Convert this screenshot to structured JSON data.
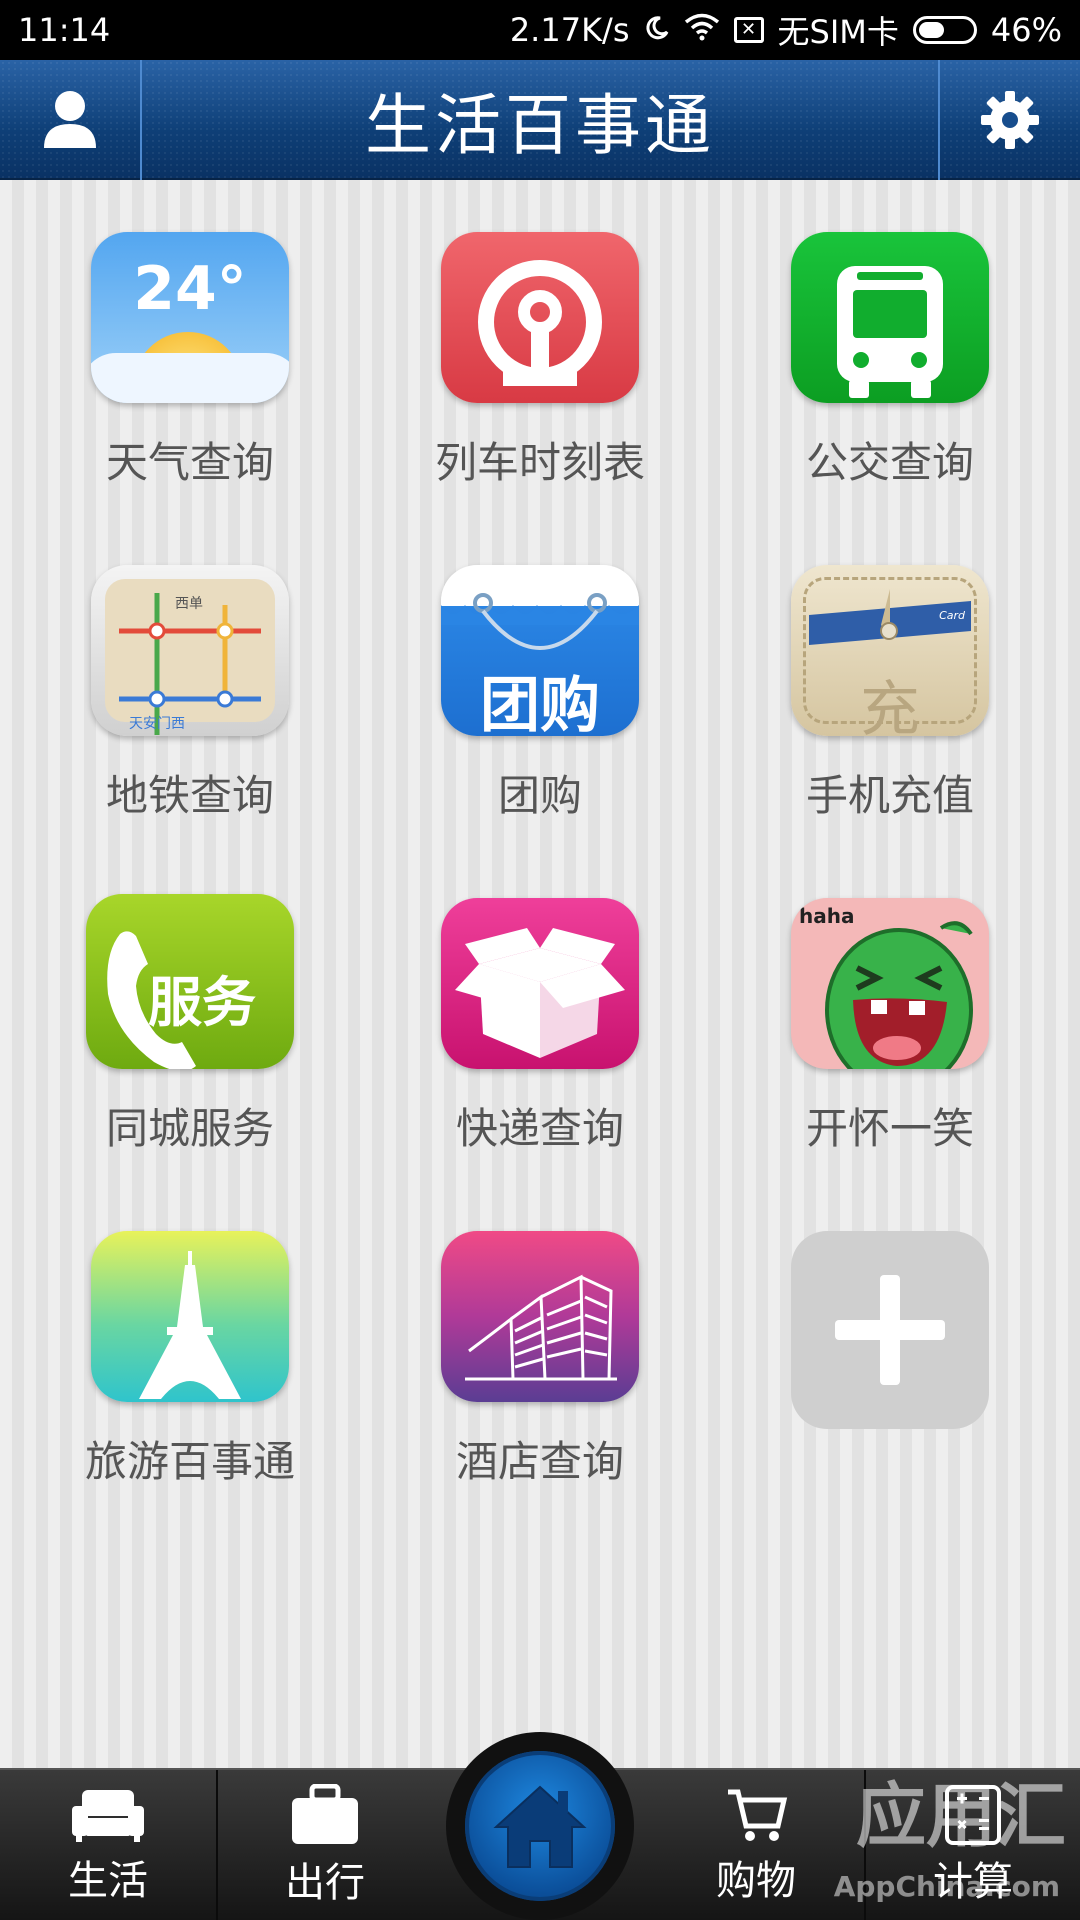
{
  "status_bar": {
    "time": "11:14",
    "speed": "2.17K/s",
    "sim": "无SIM卡",
    "battery": "46%"
  },
  "header": {
    "title": "生活百事通",
    "left_icon": "user-icon",
    "right_icon": "gear-icon"
  },
  "tiles": [
    {
      "label": "天气查询",
      "icon": "weather-icon",
      "text": "24°"
    },
    {
      "label": "列车时刻表",
      "icon": "train-icon"
    },
    {
      "label": "公交查询",
      "icon": "bus-icon"
    },
    {
      "label": "地铁查询",
      "icon": "metro-map-icon",
      "text_top": "西单",
      "text_bottom": "天安门西"
    },
    {
      "label": "团购",
      "icon": "group-buy-icon",
      "text": "团购"
    },
    {
      "label": "手机充值",
      "icon": "recharge-wallet-icon",
      "text": "充",
      "card": "Card"
    },
    {
      "label": "同城服务",
      "icon": "phone-service-icon",
      "text": "服务"
    },
    {
      "label": "快递查询",
      "icon": "package-icon"
    },
    {
      "label": "开怀一笑",
      "icon": "laughing-monster-icon",
      "text": "haha"
    },
    {
      "label": "旅游百事通",
      "icon": "eiffel-tower-icon"
    },
    {
      "label": "酒店查询",
      "icon": "building-icon"
    },
    {
      "label": "",
      "icon": "add-icon"
    }
  ],
  "bottom_nav": {
    "items": [
      {
        "label": "生活",
        "icon": "sofa-icon"
      },
      {
        "label": "出行",
        "icon": "suitcase-icon"
      },
      {
        "label": "",
        "icon": "home-icon"
      },
      {
        "label": "购物",
        "icon": "shopping-icon"
      },
      {
        "label": "计算",
        "icon": "calculator-icon"
      }
    ]
  },
  "watermark": {
    "text": "应用汇",
    "sub": "AppChina.com"
  },
  "colors": {
    "header": "#0e3f77",
    "accent": "#1e88e0"
  }
}
